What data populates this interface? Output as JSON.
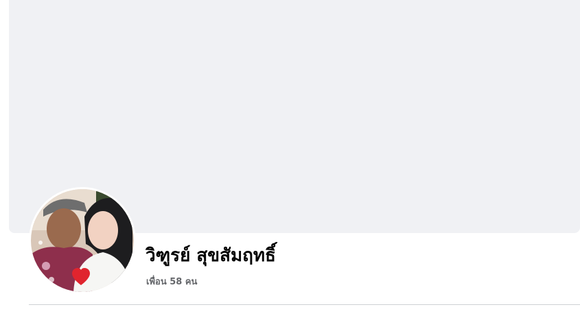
{
  "profile": {
    "name": "วิฑูรย์ สุขสัมฤทธิ์",
    "friends_count": "เพื่อน 58 คน"
  },
  "colors": {
    "cover_bg": "#f0f1f4",
    "name_color": "#050505",
    "subtext_color": "#65676b",
    "divider": "#ced0d4"
  },
  "icons": {
    "avatar_badge": "heart-icon"
  }
}
